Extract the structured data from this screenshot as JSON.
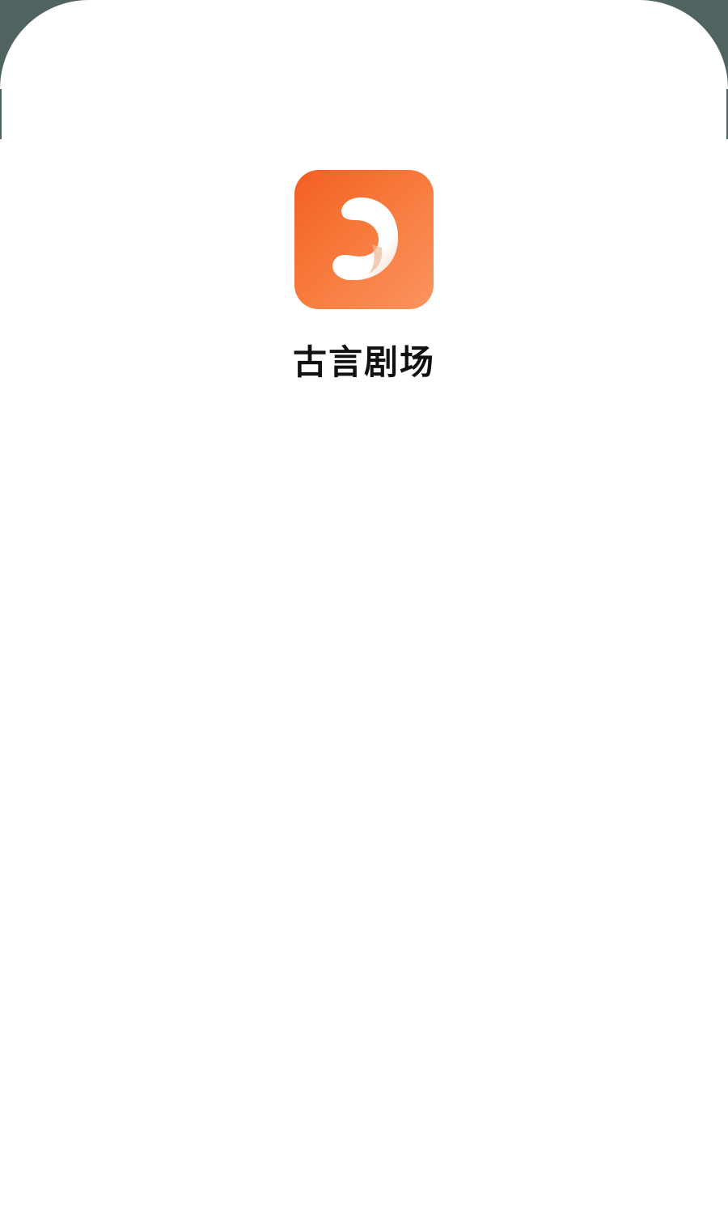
{
  "app": {
    "name": "古言剧场",
    "icon": "play-d-logo-icon"
  },
  "colors": {
    "background_dark": "#4f6460",
    "sheet": "#ffffff",
    "icon_gradient_start": "#f25f22",
    "icon_gradient_end": "#fb9460",
    "title_text": "#111111"
  }
}
